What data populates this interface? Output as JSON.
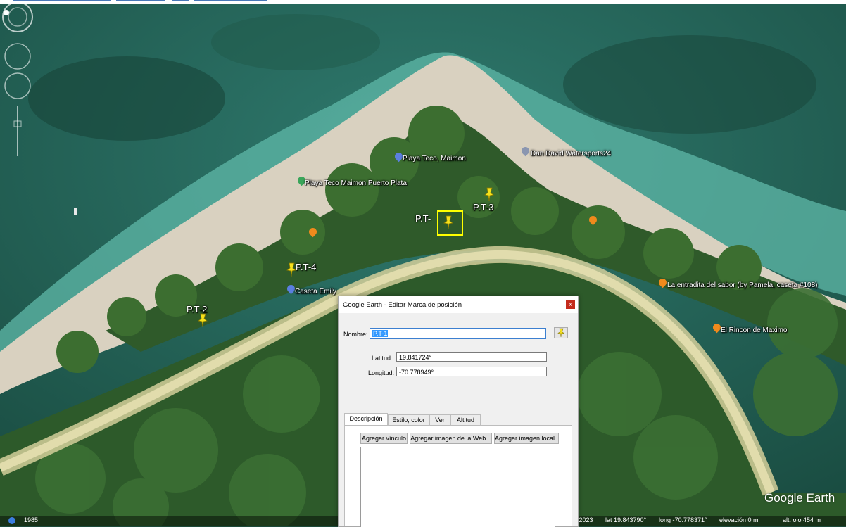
{
  "map": {
    "labels": {
      "playa_teco_maimon": "Playa Teco, Maimon",
      "dan_david": "Dan David Watersports24",
      "playa_teco_puerto_plata": "Playa Teco Maimon Puerto Plata",
      "caseta_emily": "Caseta Emily",
      "la_entradita": "La entradita del sabor (by Pamela, caseta #108)",
      "el_rincon": "El Rincon de Maximo"
    },
    "placemarks": {
      "pt1": "P.T-",
      "pt2": "P.T-2",
      "pt3": "P.T-3",
      "pt4": "P.T-4"
    },
    "watermark": "Google Earth"
  },
  "status_bar": {
    "history_year": "1985",
    "date": "/2023",
    "lat": "lat  19.843790°",
    "long": "long  -70.778371°",
    "elevation": "elevación     0 m",
    "eye_alt": "alt. ojo   454 m"
  },
  "dialog": {
    "title": "Google Earth - Editar Marca de posición",
    "close": "x",
    "name_label": "Nombre:",
    "name_value": "P.T-1",
    "lat_label": "Latitud:",
    "lat_value": "19.841724°",
    "lon_label": "Longitud:",
    "lon_value": "-70.778949°",
    "tabs": [
      "Descripción",
      "Estilo, color",
      "Ver",
      "Altitud"
    ],
    "buttons": {
      "add_link": "Agregar vínculo",
      "add_web_image": "Agregar imagen de la Web...",
      "add_local_image": "Agregar imagen local..."
    }
  },
  "colors": {
    "pin_yellow": "#f5e11c",
    "selection_box": "#ffff00",
    "poi_blue": "#5b7fe0",
    "poi_orange": "#f08a1c",
    "poi_green": "#3aa55a",
    "close_red": "#c42b1c"
  },
  "icons": [
    "pushpin-icon",
    "close-icon",
    "poi-marker-icon",
    "compass-icon",
    "history-icon"
  ]
}
